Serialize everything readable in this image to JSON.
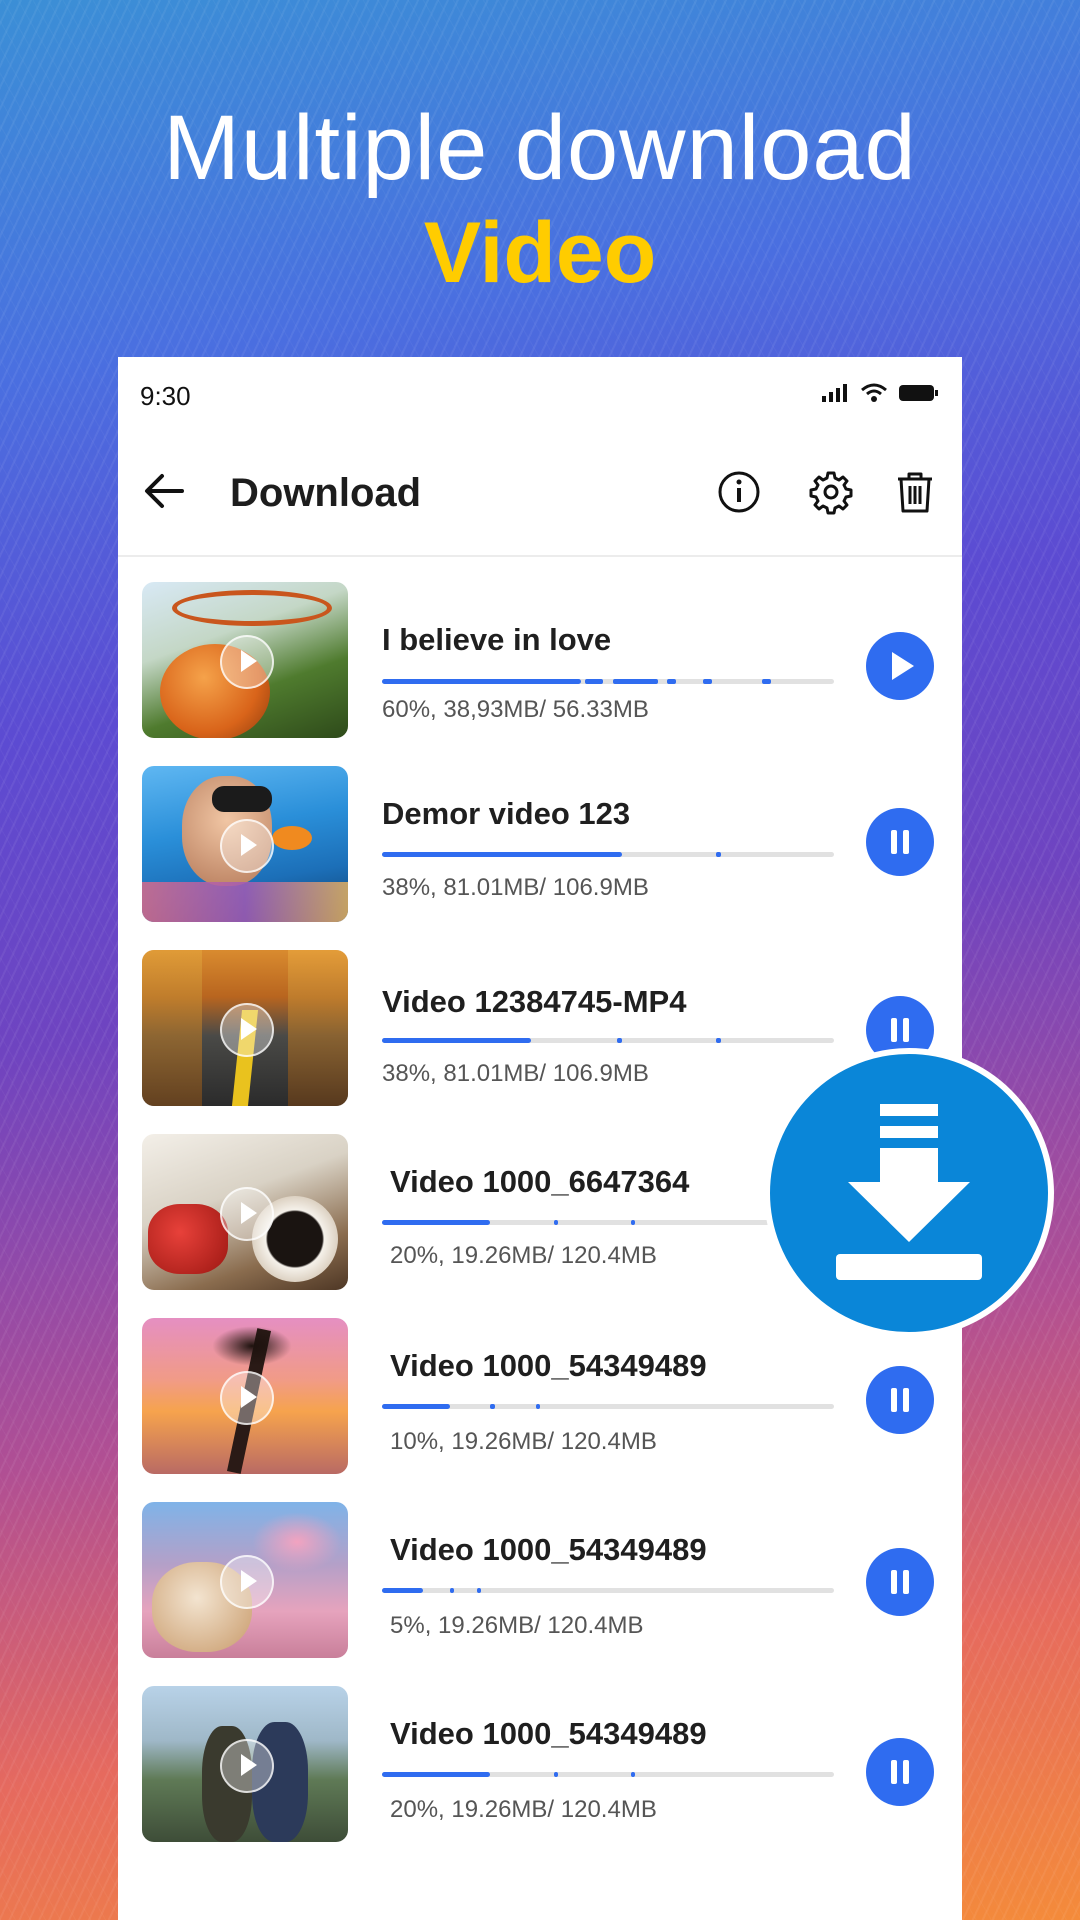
{
  "headline": {
    "line1": "Multiple download",
    "line2": "Video"
  },
  "status_bar": {
    "time": "9:30"
  },
  "app_bar": {
    "title": "Download"
  },
  "downloads": [
    {
      "name": "I believe in love",
      "progress": 0.6,
      "info": "60%, 38,93MB/ 56.33MB",
      "state": "paused",
      "action_icon": "play-icon"
    },
    {
      "name": "Demor video 123",
      "progress": 0.38,
      "info": "38%, 81.01MB/ 106.9MB",
      "state": "downloading",
      "action_icon": "pause-icon"
    },
    {
      "name": "Video 12384745-MP4",
      "progress": 0.38,
      "info": "38%, 81.01MB/ 106.9MB",
      "state": "downloading",
      "action_icon": "pause-icon"
    },
    {
      "name": "Video 1000_6647364",
      "progress": 0.2,
      "info": "20%, 19.26MB/ 120.4MB",
      "state": "downloading",
      "action_icon": "pause-icon"
    },
    {
      "name": "Video 1000_54349489",
      "progress": 0.1,
      "info": "10%, 19.26MB/ 120.4MB",
      "state": "downloading",
      "action_icon": "pause-icon"
    },
    {
      "name": "Video 1000_54349489",
      "progress": 0.05,
      "info": "5%, 19.26MB/ 120.4MB",
      "state": "downloading",
      "action_icon": "pause-icon"
    },
    {
      "name": "Video 1000_54349489",
      "progress": 0.2,
      "info": "20%, 19.26MB/ 120.4MB",
      "state": "downloading",
      "action_icon": "pause-icon"
    }
  ],
  "colors": {
    "accent": "#2f6cf0",
    "headline_highlight": "#ffcc00",
    "badge": "#0a86d8"
  },
  "icons": [
    "back-arrow-icon",
    "info-icon",
    "gear-icon",
    "trash-icon",
    "download-badge-icon"
  ]
}
